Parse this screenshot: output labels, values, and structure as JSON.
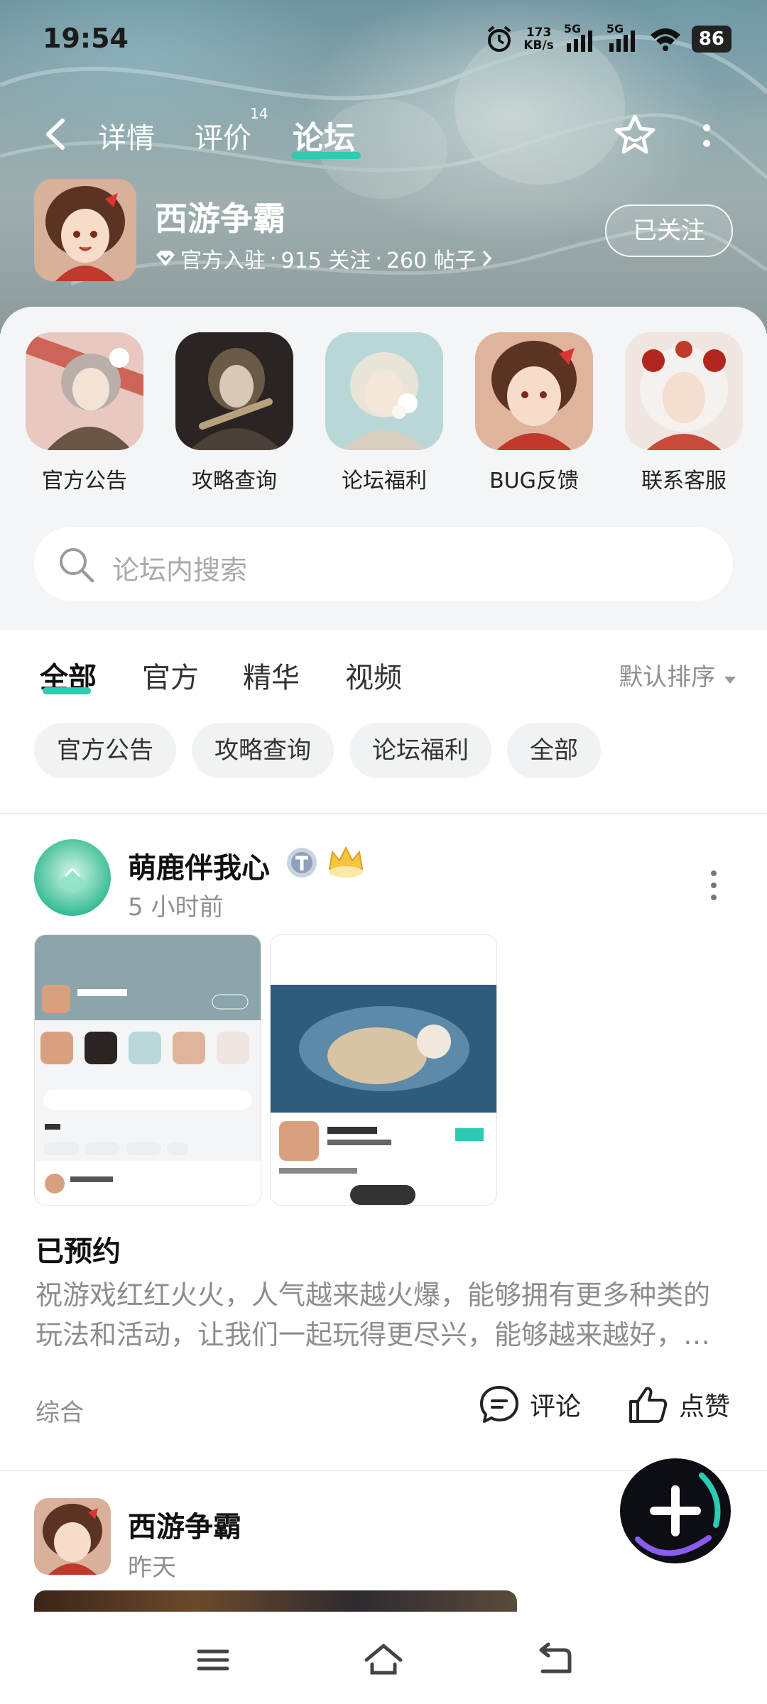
{
  "status_bar": {
    "time": "19:54",
    "net_speed_value": "173",
    "net_speed_unit": "KB/s",
    "signal_label_1": "5G",
    "signal_label_2": "5G",
    "battery": "86"
  },
  "nav": {
    "tabs": [
      {
        "label": "详情"
      },
      {
        "label": "评价"
      },
      {
        "label": "论坛"
      }
    ],
    "review_count": "14",
    "active_tab": "论坛",
    "accent_color": "#2ecbb3"
  },
  "game": {
    "title": "西游争霸",
    "official": "官方入驻",
    "followers": "915 关注",
    "posts": "260 帖子",
    "follow_button": "已关注"
  },
  "shortcuts": [
    {
      "label": "官方公告"
    },
    {
      "label": "攻略查询"
    },
    {
      "label": "论坛福利"
    },
    {
      "label": "BUG反馈"
    },
    {
      "label": "联系客服"
    }
  ],
  "search": {
    "placeholder": "论坛内搜索"
  },
  "filter_tabs": [
    {
      "label": "全部"
    },
    {
      "label": "官方"
    },
    {
      "label": "精华"
    },
    {
      "label": "视频"
    }
  ],
  "sort_label": "默认排序",
  "chips": [
    {
      "label": "官方公告"
    },
    {
      "label": "攻略查询"
    },
    {
      "label": "论坛福利"
    },
    {
      "label": "全部"
    }
  ],
  "post1": {
    "author": "萌鹿伴我心",
    "time": "5 小时前",
    "title": "已预约",
    "body": "祝游戏红红火火，人气越来越火爆，能够拥有更多种类的玩法和活动，让我们一起玩得更尽兴，能够越来越好，越来越受欢迎",
    "category": "综合",
    "comment_label": "评论",
    "like_label": "点赞"
  },
  "post2": {
    "author": "西游争霸",
    "time": "昨天"
  }
}
